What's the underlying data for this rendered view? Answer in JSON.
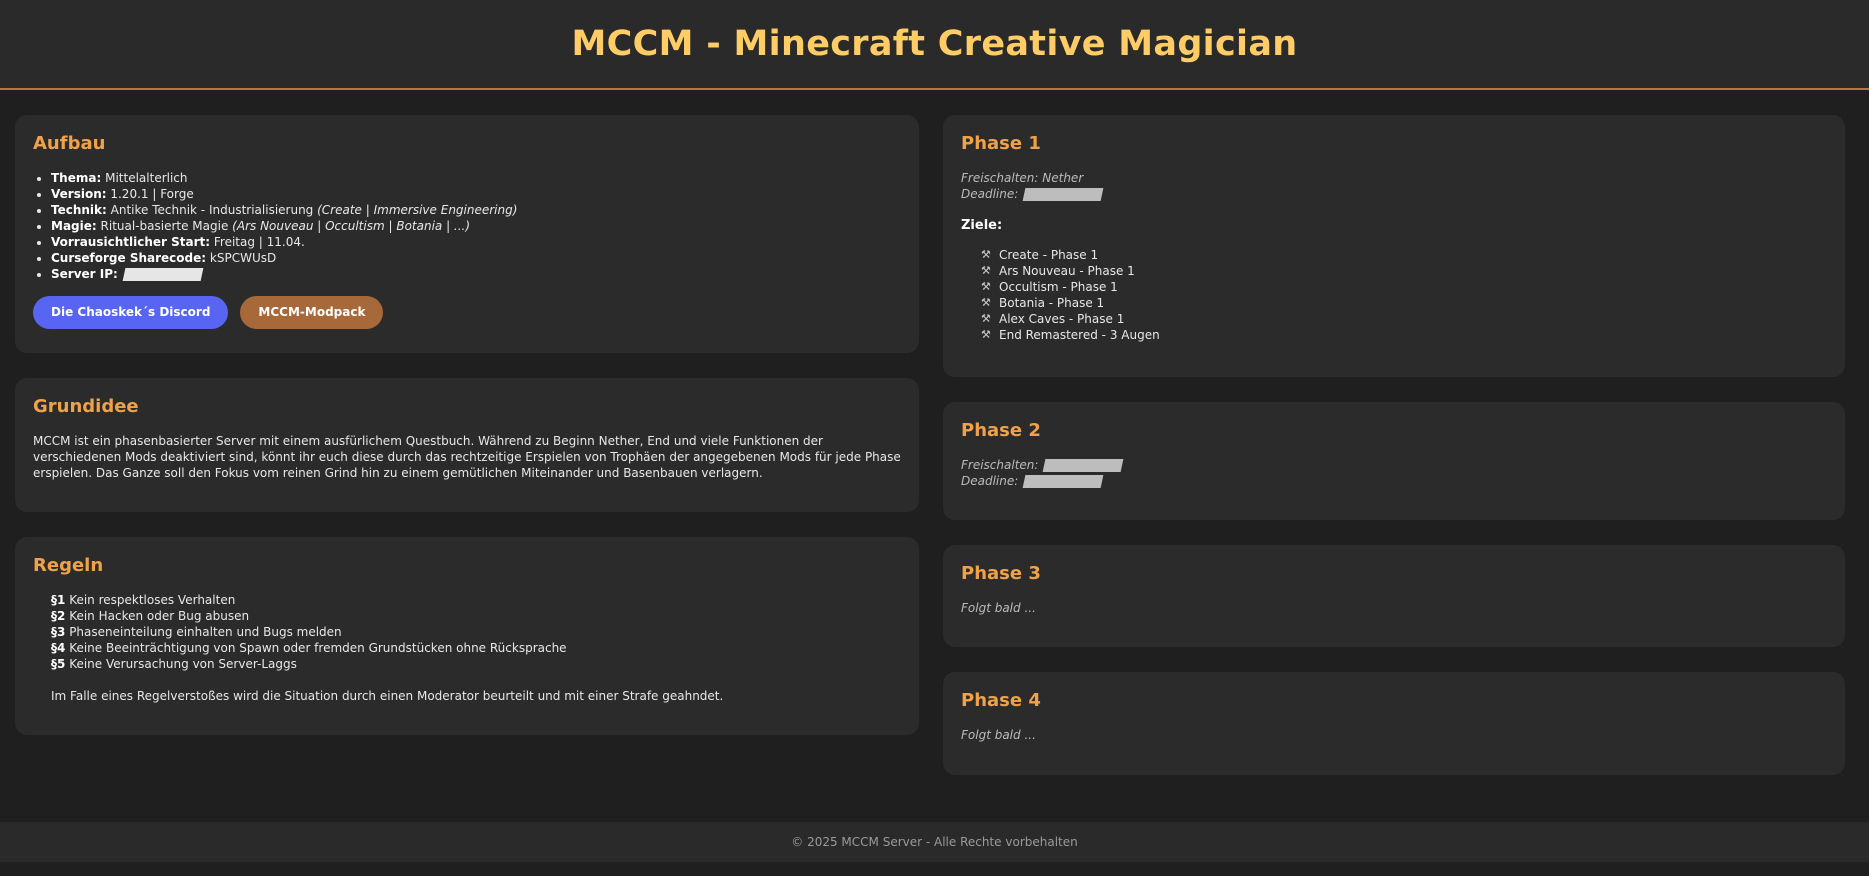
{
  "header": {
    "title": "MCCM - Minecraft Creative Magician"
  },
  "aufbau": {
    "title": "Aufbau",
    "facts": [
      {
        "label": "Thema:",
        "value": "Mittelalterlich",
        "extra": ""
      },
      {
        "label": "Version:",
        "value": "1.20.1 | Forge",
        "extra": ""
      },
      {
        "label": "Technik:",
        "value": "Antike Technik - Industrialisierung",
        "extra": "(Create | Immersive Engineering)"
      },
      {
        "label": "Magie:",
        "value": "Ritual-basierte Magie",
        "extra": "(Ars Nouveau | Occultism | Botania | ...)"
      },
      {
        "label": "Vorrausichtlicher Start:",
        "value": "Freitag | 11.04.",
        "extra": ""
      },
      {
        "label": "Curseforge Sharecode:",
        "value": "kSPCWUsD",
        "extra": ""
      },
      {
        "label": "Server IP:",
        "value": "",
        "extra": ""
      }
    ],
    "buttons": {
      "discord": "Die Chaoskek´s Discord",
      "modpack": "MCCM-Modpack"
    }
  },
  "grundidee": {
    "title": "Grundidee",
    "text": "MCCM ist ein phasenbasierter Server mit einem ausfürlichem Questbuch. Während zu Beginn Nether, End und viele Funktionen der verschiedenen Mods deaktiviert sind, könnt ihr euch diese durch das rechtzeitige Erspielen von Trophäen der angegebenen Mods für jede Phase erspielen. Das Ganze soll den Fokus vom reinen Grind hin zu einem gemütlichen Miteinander und Basenbauen verlagern."
  },
  "regeln": {
    "title": "Regeln",
    "rules": [
      {
        "num": "§1",
        "text": "Kein respektloses Verhalten"
      },
      {
        "num": "§2",
        "text": "Kein Hacken oder Bug abusen"
      },
      {
        "num": "§3",
        "text": "Phaseneinteilung einhalten und Bugs melden"
      },
      {
        "num": "§4",
        "text": "Keine Beeinträchtigung von Spawn oder fremden Grundstücken ohne Rücksprache"
      },
      {
        "num": "§5",
        "text": "Keine Verursachung von Server-Laggs"
      }
    ],
    "note": "Im Falle eines Regelverstoßes wird die Situation durch einen Moderator beurteilt und mit einer Strafe geahndet."
  },
  "phase1": {
    "title": "Phase 1",
    "unlock_label": "Freischalten:",
    "unlock_value": "Nether",
    "deadline_label": "Deadline:",
    "goals_title": "Ziele:",
    "goals": [
      "Create - Phase 1",
      "Ars Nouveau - Phase 1",
      "Occultism - Phase 1",
      "Botania - Phase 1",
      "Alex Caves - Phase 1",
      "End Remastered - 3 Augen"
    ]
  },
  "phase2": {
    "title": "Phase 2",
    "unlock_label": "Freischalten:",
    "deadline_label": "Deadline:"
  },
  "phase3": {
    "title": "Phase 3",
    "text": "Folgt bald ..."
  },
  "phase4": {
    "title": "Phase 4",
    "text": "Folgt bald ..."
  },
  "footer": {
    "text": "© 2025 MCCM Server - Alle Rechte vorbehalten"
  },
  "icons": {
    "goal": "pickaxe-icon"
  }
}
